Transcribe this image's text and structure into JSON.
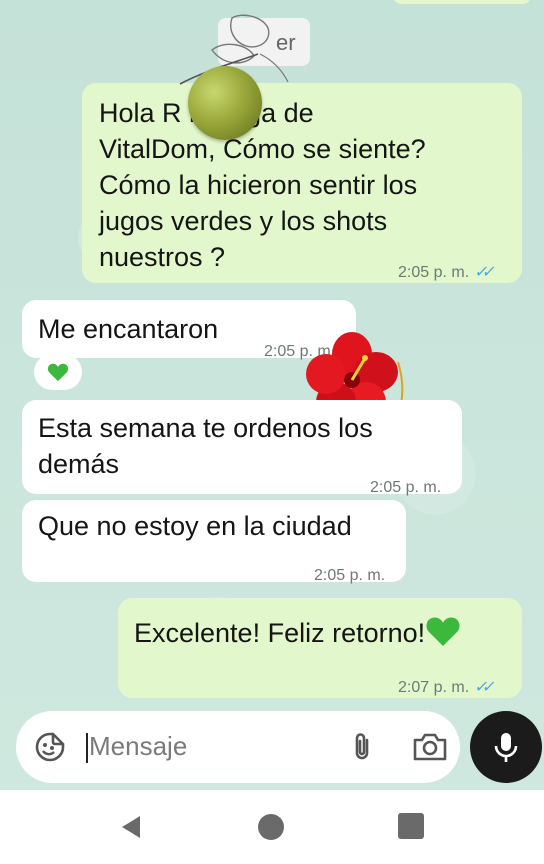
{
  "chat": {
    "sender_chip_partial": "er",
    "messages": [
      {
        "direction": "outgoing",
        "text": "Hola R          n! Olga de\nVitalDom, Cómo se siente?\nCómo la hicieron sentir los\njugos verdes y los shots\nnuestros ?",
        "time": "2:05 p. m.",
        "status_icon": "double-check-read-icon"
      },
      {
        "direction": "incoming",
        "text": "Me encantaron",
        "time": "2:05 p. m.",
        "reaction": "green-heart"
      },
      {
        "direction": "incoming",
        "text": "Esta semana te ordenos los\ndemás",
        "time": "2:05 p. m."
      },
      {
        "direction": "incoming",
        "text": "Que no estoy en la ciudad",
        "time": "2:05 p. m."
      },
      {
        "direction": "outgoing",
        "text": "Excelente! Feliz retorno!",
        "time": "2:07 p. m.",
        "status_icon": "double-check-read-icon",
        "trailing_emoji": "green-heart"
      }
    ],
    "stickers": [
      "apple-sticker",
      "hibiscus-sticker"
    ]
  },
  "composer": {
    "placeholder": "Mensaje",
    "icons": [
      "sticker-icon",
      "attach-icon",
      "camera-icon",
      "mic-icon"
    ]
  },
  "navigation": {
    "icons": [
      "back-icon",
      "home-icon",
      "recents-icon"
    ]
  },
  "colors": {
    "wallpaper": "#c8e4da",
    "outgoing_bubble": "#e2f7cb",
    "incoming_bubble": "#ffffff",
    "read_ticks": "#4aa3e8",
    "heart_green": "#3cb83c",
    "mic_button": "#1b1b1b"
  }
}
